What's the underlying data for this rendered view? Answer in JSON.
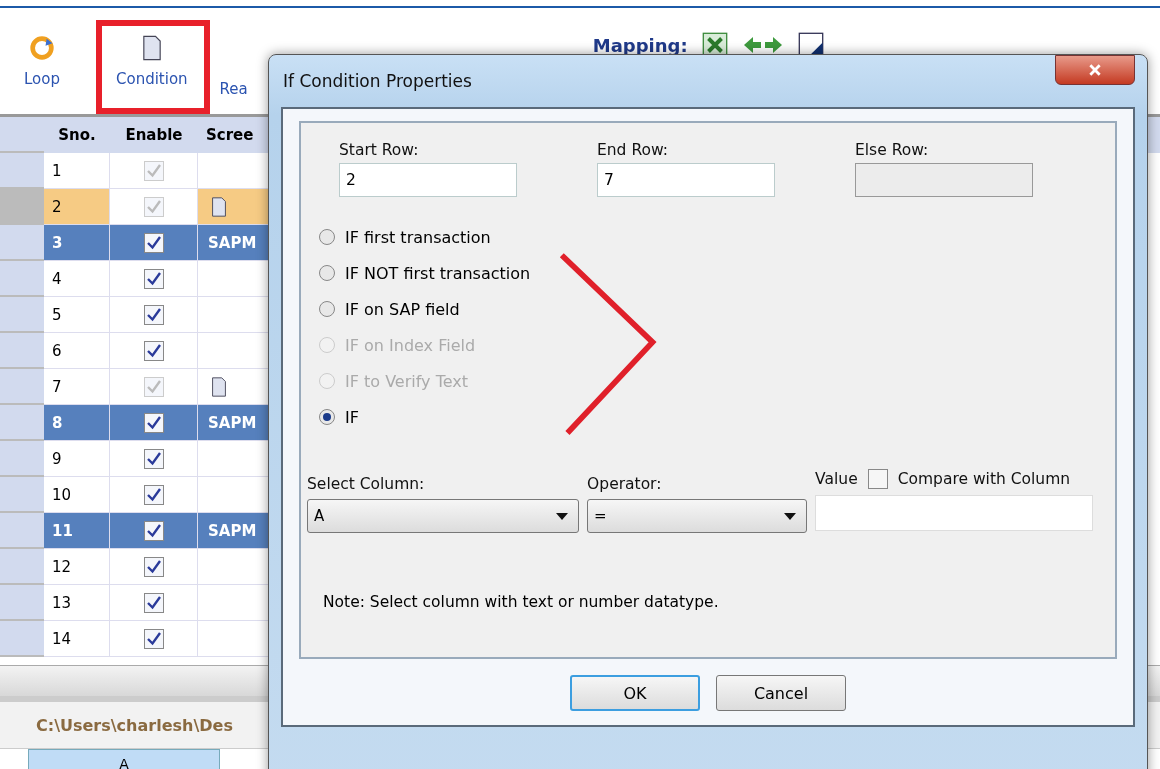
{
  "toolbar": {
    "items": [
      {
        "label": "Loop",
        "kind": "loop"
      },
      {
        "label": "Condition",
        "kind": "condition"
      },
      {
        "label": "Rea",
        "kind": "text"
      }
    ],
    "mapping_label": "Mapping:"
  },
  "table": {
    "columns": [
      "Sno.",
      "Enable",
      "Scree"
    ],
    "rows": [
      {
        "sno": "1",
        "checked": true,
        "disabled": true,
        "kind": "plain"
      },
      {
        "sno": "2",
        "checked": true,
        "disabled": true,
        "kind": "current",
        "icon": true
      },
      {
        "sno": "3",
        "checked": true,
        "disabled": false,
        "kind": "screen",
        "screen": "SAPM"
      },
      {
        "sno": "4",
        "checked": true,
        "disabled": false,
        "kind": "plain"
      },
      {
        "sno": "5",
        "checked": true,
        "disabled": false,
        "kind": "plain"
      },
      {
        "sno": "6",
        "checked": true,
        "disabled": false,
        "kind": "plain"
      },
      {
        "sno": "7",
        "checked": true,
        "disabled": true,
        "kind": "plain",
        "icon": true
      },
      {
        "sno": "8",
        "checked": true,
        "disabled": false,
        "kind": "screen",
        "screen": "SAPM"
      },
      {
        "sno": "9",
        "checked": true,
        "disabled": false,
        "kind": "plain"
      },
      {
        "sno": "10",
        "checked": true,
        "disabled": false,
        "kind": "plain"
      },
      {
        "sno": "11",
        "checked": true,
        "disabled": false,
        "kind": "screen",
        "screen": "SAPM"
      },
      {
        "sno": "12",
        "checked": true,
        "disabled": false,
        "kind": "plain"
      },
      {
        "sno": "13",
        "checked": true,
        "disabled": false,
        "kind": "plain"
      },
      {
        "sno": "14",
        "checked": true,
        "disabled": false,
        "kind": "plain"
      }
    ]
  },
  "file_tab": "C:\\Users\\charlesh\\Des",
  "sheet_columns": [
    {
      "label": "A",
      "selected": true
    }
  ],
  "dialog": {
    "title": "If Condition Properties",
    "fields": [
      {
        "label": "Start Row:",
        "value": "2",
        "disabled": false
      },
      {
        "label": "End Row:",
        "value": "7",
        "disabled": false
      },
      {
        "label": "Else Row:",
        "disabled": true
      }
    ],
    "options": [
      {
        "label": "IF first transaction",
        "selected": false,
        "disabled": false
      },
      {
        "label": "IF NOT first transaction",
        "selected": false,
        "disabled": false
      },
      {
        "label": "IF on SAP field",
        "selected": false,
        "disabled": false
      },
      {
        "label": "IF on Index Field",
        "selected": false,
        "disabled": true
      },
      {
        "label": "IF to Verify Text",
        "selected": false,
        "disabled": true
      },
      {
        "label": "IF",
        "selected": true,
        "disabled": false
      }
    ],
    "select_column": {
      "label": "Select Column:",
      "value": "A"
    },
    "operator": {
      "label": "Operator:",
      "value": "="
    },
    "value": {
      "label": "Value"
    },
    "compare": {
      "label": "Compare with Column",
      "checked": false
    },
    "note": "Note: Select column with text or number datatype.",
    "buttons": [
      "OK",
      "Cancel"
    ]
  }
}
